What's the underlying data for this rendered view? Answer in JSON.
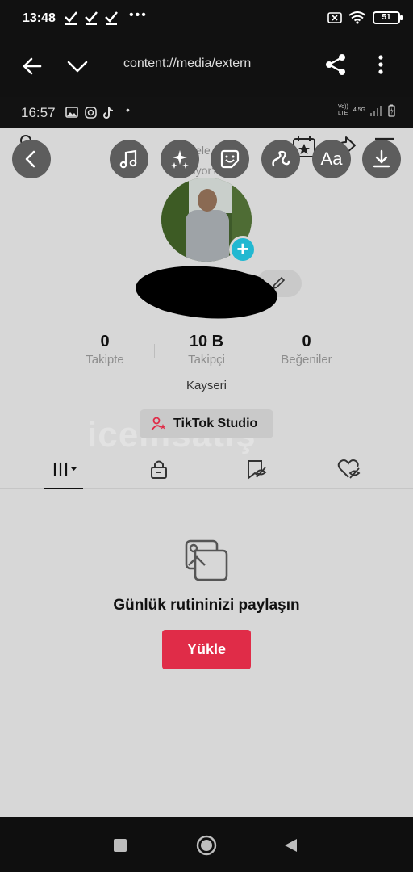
{
  "status_bar": {
    "time": "13:48",
    "overflow": "•••",
    "battery": "51"
  },
  "app_toolbar": {
    "url": "content://media/extern"
  },
  "inner_status": {
    "time": "16:57",
    "dot": "•",
    "volte": "Vo))\nLTE",
    "net": "4.5G"
  },
  "notification_overlay": {
    "line1": "Nele",
    "line2": "Biliyor?"
  },
  "editor_icons": [
    "back-arrow-icon",
    "music-icon",
    "effects-sparkle-icon",
    "sticker-icon",
    "draw-squiggle-icon",
    "text-aa-icon",
    "download-icon"
  ],
  "stats": [
    {
      "value": "0",
      "label": "Takipte"
    },
    {
      "value": "10 B",
      "label": "Takipçi"
    },
    {
      "value": "0",
      "label": "Beğeniler"
    }
  ],
  "location": "Kayseri",
  "studio_button": "TikTok Studio",
  "watermark": "icemsatış",
  "tabs": [
    "videos-grid",
    "private-lock",
    "reposts",
    "liked"
  ],
  "empty_state": {
    "title": "Günlük rutininizi paylaşın",
    "button": "Yükle"
  },
  "editor_text_label": "Aa",
  "colors": {
    "accent": "#e02c48",
    "add_badge": "#22b8d1",
    "page_bg": "#d7d7d7"
  }
}
